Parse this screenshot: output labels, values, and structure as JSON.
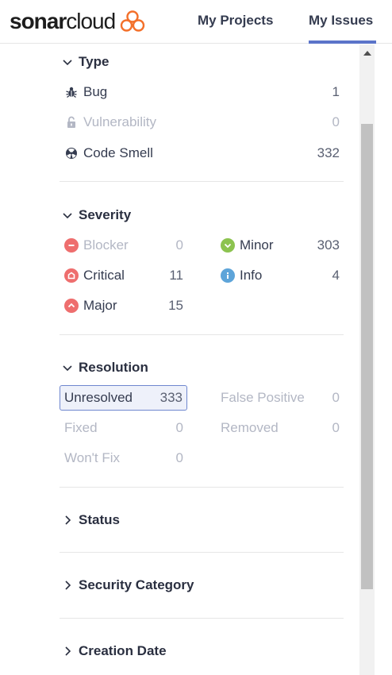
{
  "header": {
    "logo_bold": "sonar",
    "logo_light": "cloud",
    "nav": [
      {
        "label": "My Projects"
      },
      {
        "label": "My Issues"
      }
    ]
  },
  "facets": {
    "type": {
      "title": "Type",
      "items": [
        {
          "label": "Bug",
          "count": "1",
          "icon": "bug-icon"
        },
        {
          "label": "Vulnerability",
          "count": "0",
          "icon": "lock-icon"
        },
        {
          "label": "Code Smell",
          "count": "332",
          "icon": "code-smell-icon"
        }
      ]
    },
    "severity": {
      "title": "Severity",
      "items": [
        {
          "label": "Blocker",
          "count": "0",
          "icon": "blocker-icon"
        },
        {
          "label": "Minor",
          "count": "303",
          "icon": "minor-icon"
        },
        {
          "label": "Critical",
          "count": "11",
          "icon": "critical-icon"
        },
        {
          "label": "Info",
          "count": "4",
          "icon": "info-icon"
        },
        {
          "label": "Major",
          "count": "15",
          "icon": "major-icon"
        }
      ]
    },
    "resolution": {
      "title": "Resolution",
      "items": [
        {
          "label": "Unresolved",
          "count": "333"
        },
        {
          "label": "False Positive",
          "count": "0"
        },
        {
          "label": "Fixed",
          "count": "0"
        },
        {
          "label": "Removed",
          "count": "0"
        },
        {
          "label": "Won't Fix",
          "count": "0"
        }
      ]
    },
    "status": {
      "title": "Status"
    },
    "security_category": {
      "title": "Security Category"
    },
    "creation_date": {
      "title": "Creation Date"
    }
  },
  "colors": {
    "accent": "#5b74c9",
    "severity_red": "#ee6e6e",
    "minor_green": "#8cc34f",
    "info_blue": "#5da4d9"
  }
}
